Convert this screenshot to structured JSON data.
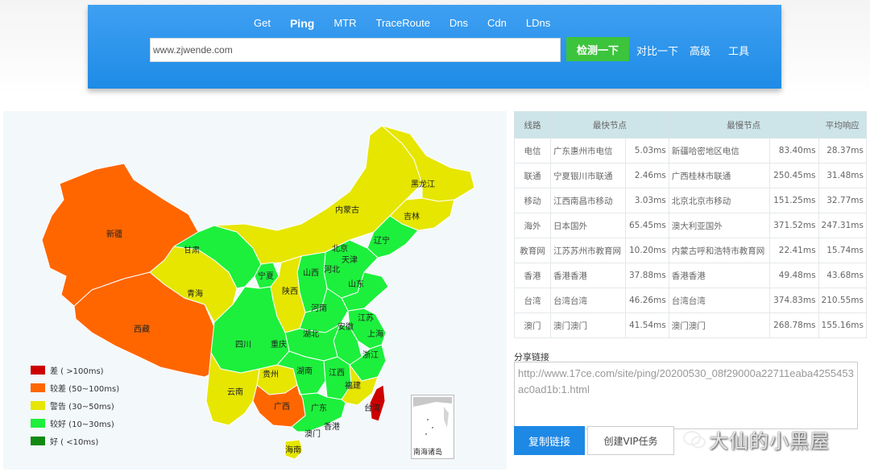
{
  "nav": {
    "tabs": [
      "Get",
      "Ping",
      "MTR",
      "TraceRoute",
      "Dns",
      "Cdn",
      "LDns"
    ],
    "active_tab": "Ping"
  },
  "search": {
    "value": "www.zjwende.com",
    "check_button": "检测一下",
    "compare_link": "对比一下",
    "advanced_link": "高级",
    "tools_link": "工具"
  },
  "colors": {
    "bad": "#cc0000",
    "poor": "#ff6600",
    "warn": "#e6e600",
    "good": "#1cf03c",
    "great": "#118a11"
  },
  "legend": [
    {
      "label": "差 ( >100ms)",
      "color": "#cc0000"
    },
    {
      "label": "较差 (50~100ms)",
      "color": "#ff6600"
    },
    {
      "label": "警告 (30~50ms)",
      "color": "#e6e600"
    },
    {
      "label": "较好 (10~30ms)",
      "color": "#1cf03c"
    },
    {
      "label": "好 ( <10ms)",
      "color": "#118a11"
    }
  ],
  "map": {
    "inset_label": "南海诸岛",
    "provinces": [
      {
        "name": "新疆",
        "level": "poor"
      },
      {
        "name": "西藏",
        "level": "poor"
      },
      {
        "name": "青海",
        "level": "warn"
      },
      {
        "name": "甘肃",
        "level": "good"
      },
      {
        "name": "内蒙古",
        "level": "warn"
      },
      {
        "name": "黑龙江",
        "level": "warn"
      },
      {
        "name": "吉林",
        "level": "warn"
      },
      {
        "name": "辽宁",
        "level": "good"
      },
      {
        "name": "北京",
        "level": "good"
      },
      {
        "name": "天津",
        "level": "good"
      },
      {
        "name": "河北",
        "level": "good"
      },
      {
        "name": "山西",
        "level": "good"
      },
      {
        "name": "宁夏",
        "level": "good"
      },
      {
        "name": "陕西",
        "level": "warn"
      },
      {
        "name": "山东",
        "level": "good"
      },
      {
        "name": "河南",
        "level": "good"
      },
      {
        "name": "江苏",
        "level": "good"
      },
      {
        "name": "安徽",
        "level": "good"
      },
      {
        "name": "上海",
        "level": "good"
      },
      {
        "name": "湖北",
        "level": "good"
      },
      {
        "name": "四川",
        "level": "good"
      },
      {
        "name": "重庆",
        "level": "good"
      },
      {
        "name": "浙江",
        "level": "good"
      },
      {
        "name": "贵州",
        "level": "warn"
      },
      {
        "name": "湖南",
        "level": "good"
      },
      {
        "name": "江西",
        "level": "good"
      },
      {
        "name": "福建",
        "level": "warn"
      },
      {
        "name": "云南",
        "level": "warn"
      },
      {
        "name": "广西",
        "level": "poor"
      },
      {
        "name": "广东",
        "level": "good"
      },
      {
        "name": "台湾",
        "level": "bad"
      },
      {
        "name": "香港",
        "level": "warn"
      },
      {
        "name": "澳门",
        "level": "good"
      },
      {
        "name": "海南",
        "level": "warn"
      }
    ]
  },
  "table": {
    "headers": [
      "线路",
      "最快节点",
      "最慢节点",
      "平均响应"
    ],
    "rows": [
      {
        "line": "电信",
        "fast_node": "广东惠州市电信",
        "fast_ms": "5.03ms",
        "slow_node": "新疆哈密地区电信",
        "slow_ms": "83.40ms",
        "avg": "28.37ms"
      },
      {
        "line": "联通",
        "fast_node": "宁夏银川市联通",
        "fast_ms": "2.46ms",
        "slow_node": "广西桂林市联通",
        "slow_ms": "250.45ms",
        "avg": "31.48ms"
      },
      {
        "line": "移动",
        "fast_node": "江西南昌市移动",
        "fast_ms": "3.03ms",
        "slow_node": "北京北京市移动",
        "slow_ms": "151.25ms",
        "avg": "32.77ms"
      },
      {
        "line": "海外",
        "fast_node": "日本国外",
        "fast_ms": "65.45ms",
        "slow_node": "澳大利亚国外",
        "slow_ms": "371.52ms",
        "avg": "247.31ms"
      },
      {
        "line": "教育网",
        "fast_node": "江苏苏州市教育网",
        "fast_ms": "10.20ms",
        "slow_node": "内蒙古呼和浩特市教育网",
        "slow_ms": "22.41ms",
        "avg": "15.74ms"
      },
      {
        "line": "香港",
        "fast_node": "香港香港",
        "fast_ms": "37.88ms",
        "slow_node": "香港香港",
        "slow_ms": "49.48ms",
        "avg": "43.68ms"
      },
      {
        "line": "台湾",
        "fast_node": "台湾台湾",
        "fast_ms": "46.26ms",
        "slow_node": "台湾台湾",
        "slow_ms": "374.83ms",
        "avg": "210.55ms"
      },
      {
        "line": "澳门",
        "fast_node": "澳门澳门",
        "fast_ms": "41.54ms",
        "slow_node": "澳门澳门",
        "slow_ms": "268.78ms",
        "avg": "155.16ms"
      }
    ]
  },
  "share": {
    "label": "分享链接",
    "url": "http://www.17ce.com/site/ping/20200530_08f29000a22711eaba4255453ac0ad1b:1.html",
    "copy_button": "复制链接",
    "vip_button": "创建VIP任务"
  },
  "watermark": {
    "text": "大仙的小黑屋",
    "icon": "wechat-icon"
  }
}
